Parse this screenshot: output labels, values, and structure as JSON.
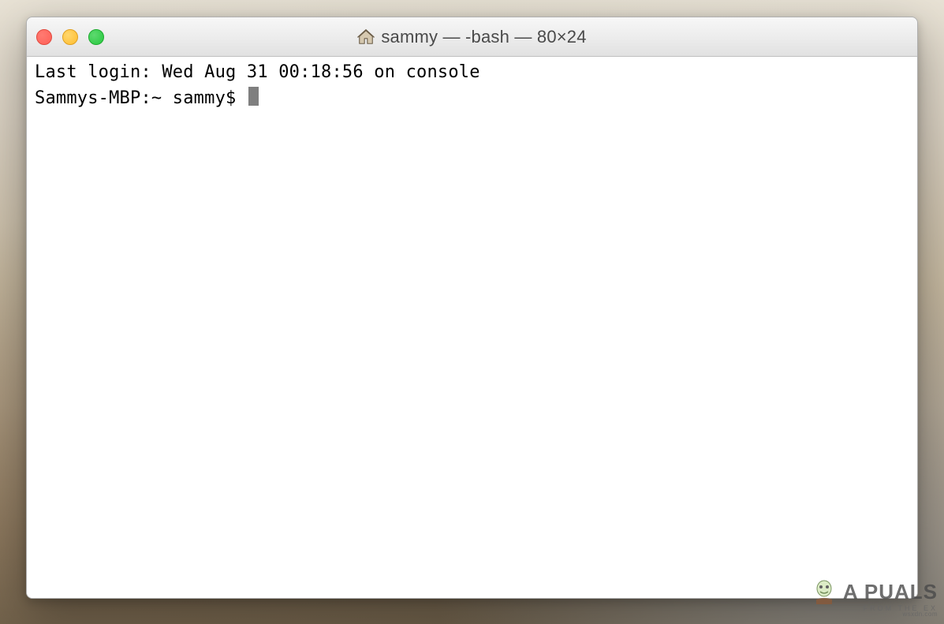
{
  "window": {
    "title": "sammy — -bash — 80×24"
  },
  "terminal": {
    "last_login": "Last login: Wed Aug 31 00:18:56 on console",
    "prompt": "Sammys-MBP:~ sammy$ "
  },
  "watermark": {
    "brand": "A  PUALS",
    "tagline": "FROM THE EX",
    "tiny": "wsxdn.com"
  }
}
